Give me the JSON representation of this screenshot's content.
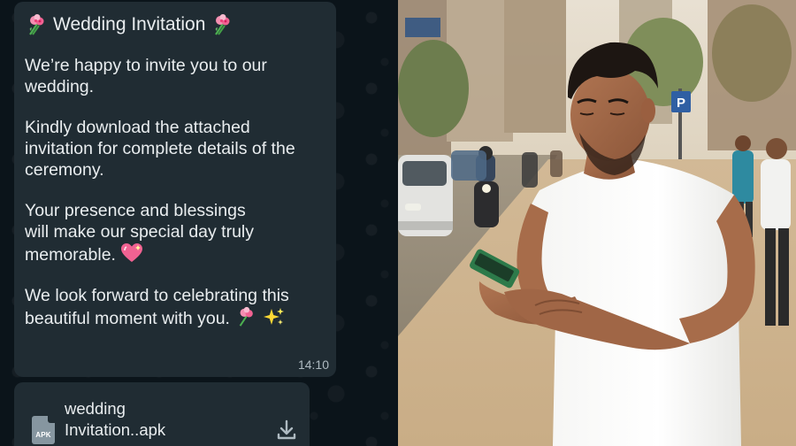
{
  "message": {
    "title": "Wedding Invitation",
    "line1": "We’re happy to invite you to our wedding.",
    "line2": "Kindly download the attached invitation for complete details of the ceremony.",
    "line3a": "Your presence and blessings",
    "line3b": "will make our special day truly",
    "line3c": "memorable.",
    "line4a": "We look forward to celebrating this",
    "line4b": "beautiful moment with you.",
    "time": "14:10"
  },
  "attachment": {
    "file_name_line1": "wedding",
    "file_name_line2": "Invitation..apk",
    "file_type": "APK",
    "icon": "download-icon"
  },
  "colors": {
    "chat_background": "#0b141a",
    "bubble": "#202c33",
    "text": "#e9edef",
    "timestamp": "#aebac1"
  },
  "photo": {
    "subject": "man-reading-phone-on-street"
  }
}
